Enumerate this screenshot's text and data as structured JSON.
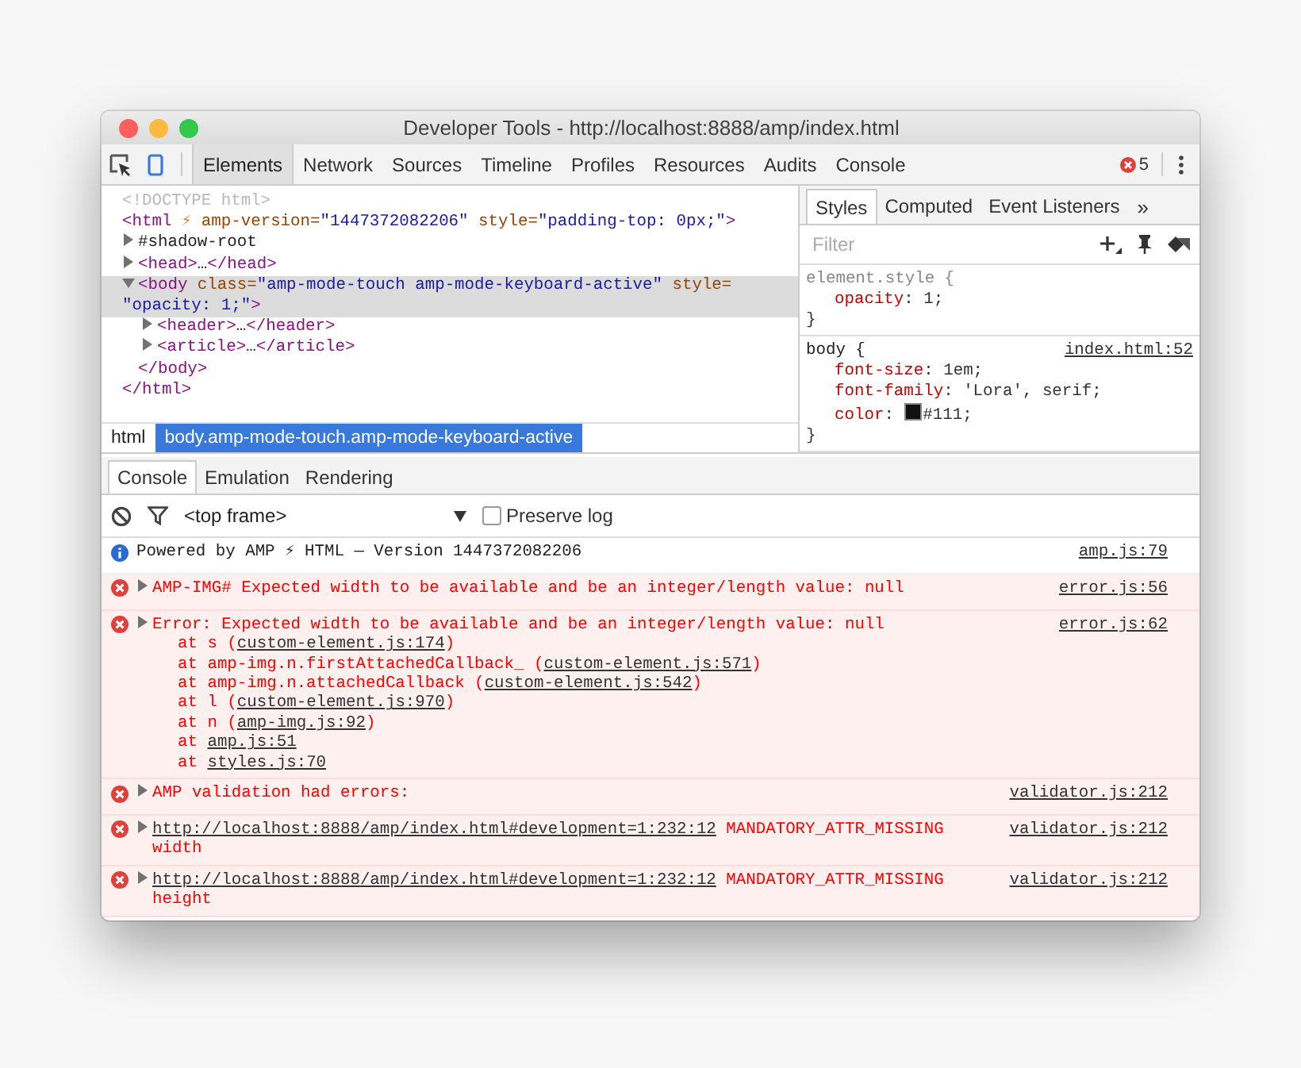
{
  "window": {
    "title": "Developer Tools - http://localhost:8888/amp/index.html"
  },
  "toolbar": {
    "tabs": [
      {
        "label": "Elements",
        "selected": true
      },
      {
        "label": "Network",
        "selected": false
      },
      {
        "label": "Sources",
        "selected": false
      },
      {
        "label": "Timeline",
        "selected": false
      },
      {
        "label": "Profiles",
        "selected": false
      },
      {
        "label": "Resources",
        "selected": false
      },
      {
        "label": "Audits",
        "selected": false
      },
      {
        "label": "Console",
        "selected": false
      }
    ],
    "error_count": "5"
  },
  "elements": {
    "dom": [
      {
        "tokens": [
          {
            "kind": "doctype",
            "text": "<!DOCTYPE html>"
          }
        ],
        "selected": false
      },
      {
        "tokens": [
          {
            "kind": "tag",
            "text": "<html"
          },
          {
            "kind": "bolt",
            "text": " ⚡"
          },
          {
            "kind": "attr",
            "text": " amp-version="
          },
          {
            "kind": "value",
            "text": "\"1447372082206\""
          },
          {
            "kind": "attr",
            "text": " style="
          },
          {
            "kind": "value",
            "text": "\"padding-top: 0px;\""
          },
          {
            "kind": "tag",
            "text": ">"
          }
        ],
        "selected": false,
        "children": [
          {
            "tokens": [
              {
                "kind": "plain",
                "text": "#shadow-root"
              }
            ],
            "expanded": false,
            "selected": false
          },
          {
            "tokens": [
              {
                "kind": "tag",
                "text": "<head>"
              },
              {
                "kind": "plain",
                "text": "…"
              },
              {
                "kind": "tag",
                "text": "</head>"
              }
            ],
            "expanded": false,
            "selected": false
          },
          {
            "tokens": [
              {
                "kind": "tag",
                "text": "<body"
              },
              {
                "kind": "attr",
                "text": " class="
              },
              {
                "kind": "value",
                "text": "\"amp-mode-touch amp-mode-keyboard-active\""
              },
              {
                "kind": "attr",
                "text": " style="
              },
              {
                "kind": "value",
                "text": "\"opacity: 1;\""
              },
              {
                "kind": "tag",
                "text": ">"
              }
            ],
            "expanded": true,
            "selected": true,
            "children": [
              {
                "tokens": [
                  {
                    "kind": "tag",
                    "text": "<header>"
                  },
                  {
                    "kind": "plain",
                    "text": "…"
                  },
                  {
                    "kind": "tag",
                    "text": "</header>"
                  }
                ],
                "expanded": false,
                "selected": false
              },
              {
                "tokens": [
                  {
                    "kind": "tag",
                    "text": "<article>"
                  },
                  {
                    "kind": "plain",
                    "text": "…"
                  },
                  {
                    "kind": "tag",
                    "text": "</article>"
                  }
                ],
                "expanded": false,
                "selected": false
              }
            ],
            "closing": "</body>"
          }
        ],
        "closing": "</html>"
      }
    ],
    "breadcrumbs": [
      {
        "label": "html",
        "selected": false
      },
      {
        "label": "body.amp-mode-touch.amp-mode-keyboard-active",
        "selected": true
      }
    ]
  },
  "styles": {
    "tabs": [
      {
        "label": "Styles",
        "selected": true
      },
      {
        "label": "Computed",
        "selected": false
      },
      {
        "label": "Event Listeners",
        "selected": false
      }
    ],
    "overflow": "»",
    "filter": {
      "placeholder": "Filter"
    },
    "rules": [
      {
        "selector": "element.style",
        "open": " {",
        "declarations": [
          {
            "property": "opacity",
            "value": ": 1;"
          }
        ],
        "close": "}"
      },
      {
        "selector": "body",
        "open": " {",
        "source": "index.html:52",
        "declarations": [
          {
            "property": "font-size",
            "value": ": 1em;"
          },
          {
            "property": "font-family",
            "value": ": 'Lora', serif;"
          },
          {
            "property": "color",
            "value": "#111;",
            "color": "#111111",
            "prefix": ": "
          }
        ],
        "close": "}"
      }
    ]
  },
  "drawer": {
    "tabs": [
      {
        "label": "Console",
        "selected": true
      },
      {
        "label": "Emulation",
        "selected": false
      },
      {
        "label": "Rendering",
        "selected": false
      }
    ]
  },
  "console": {
    "context": "<top frame>",
    "preserve_log": {
      "label": "Preserve log",
      "checked": false
    },
    "messages": [
      {
        "kind": "info",
        "expandable": false,
        "parts": [
          {
            "kind": "text",
            "text": "Powered by AMP ⚡ HTML — Version 1447372082206"
          }
        ],
        "source": "amp.js:79"
      },
      {
        "kind": "error",
        "expandable": true,
        "parts": [
          {
            "kind": "text",
            "text": "AMP-IMG# Expected width to be available and be an integer/length value: null"
          }
        ],
        "source": "error.js:56"
      },
      {
        "kind": "error",
        "expandable": true,
        "parts": [
          {
            "kind": "text",
            "text": "Error: Expected width to be available and be an integer/length value: null"
          }
        ],
        "source": "error.js:62",
        "stack": [
          [
            {
              "kind": "text",
              "text": "at s ("
            },
            {
              "kind": "link",
              "text": "custom-element.js:174"
            },
            {
              "kind": "text",
              "text": ")"
            }
          ],
          [
            {
              "kind": "text",
              "text": "at amp-img.n.firstAttachedCallback_ ("
            },
            {
              "kind": "link",
              "text": "custom-element.js:571"
            },
            {
              "kind": "text",
              "text": ")"
            }
          ],
          [
            {
              "kind": "text",
              "text": "at amp-img.n.attachedCallback ("
            },
            {
              "kind": "link",
              "text": "custom-element.js:542"
            },
            {
              "kind": "text",
              "text": ")"
            }
          ],
          [
            {
              "kind": "text",
              "text": "at l ("
            },
            {
              "kind": "link",
              "text": "custom-element.js:970"
            },
            {
              "kind": "text",
              "text": ")"
            }
          ],
          [
            {
              "kind": "text",
              "text": "at n ("
            },
            {
              "kind": "link",
              "text": "amp-img.js:92"
            },
            {
              "kind": "text",
              "text": ")"
            }
          ],
          [
            {
              "kind": "text",
              "text": "at "
            },
            {
              "kind": "link",
              "text": "amp.js:51"
            }
          ],
          [
            {
              "kind": "text",
              "text": "at "
            },
            {
              "kind": "link",
              "text": "styles.js:70"
            }
          ]
        ]
      },
      {
        "kind": "error",
        "expandable": true,
        "parts": [
          {
            "kind": "text",
            "text": "AMP validation had errors:"
          }
        ],
        "source": "validator.js:212"
      },
      {
        "kind": "error",
        "expandable": true,
        "parts": [
          {
            "kind": "link",
            "text": "http://localhost:8888/amp/index.html#development=1:232:12"
          },
          {
            "kind": "text",
            "text": " MANDATORY_ATTR_MISSING width"
          }
        ],
        "source": "validator.js:212"
      },
      {
        "kind": "error",
        "expandable": true,
        "parts": [
          {
            "kind": "link",
            "text": "http://localhost:8888/amp/index.html#development=1:232:12"
          },
          {
            "kind": "text",
            "text": " MANDATORY_ATTR_MISSING height"
          }
        ],
        "source": "validator.js:212"
      }
    ]
  }
}
